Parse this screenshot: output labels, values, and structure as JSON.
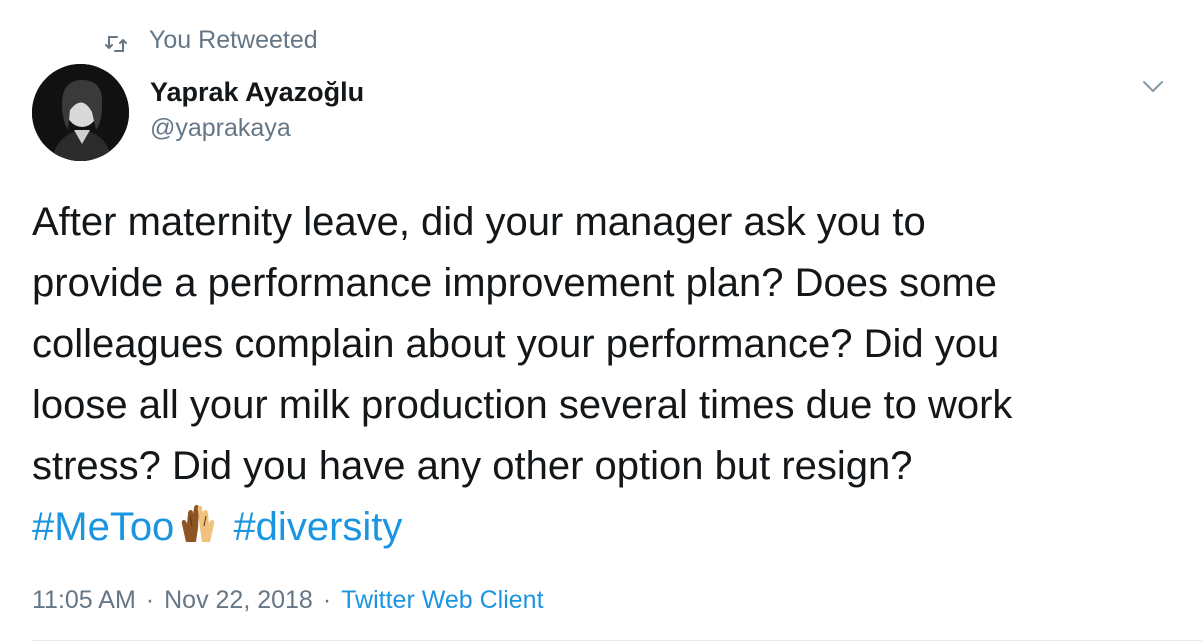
{
  "retweet_context": {
    "icon": "retweet-icon",
    "label": "You Retweeted"
  },
  "author": {
    "avatar_icon": "avatar",
    "name": "Yaprak Ayazoğlu",
    "handle": "@yaprakaya"
  },
  "menu": {
    "icon": "chevron-down-icon"
  },
  "tweet": {
    "lines": [
      "After maternity leave, did your manager ask you to",
      "provide a performance improvement plan? Does some",
      "colleagues complain about your performance? Did you",
      "loose all your milk production several times due to work",
      "stress? Did you have any other option but resign?"
    ],
    "hashtag_1": "#MeToo",
    "emoji": "raising-hands-emoji",
    "hashtag_2": "#diversity"
  },
  "meta": {
    "time": "11:05 AM",
    "separator": "·",
    "date": "Nov 22, 2018",
    "client": "Twitter Web Client"
  },
  "colors": {
    "link": "#1b95e0",
    "secondary_text": "#657786",
    "primary_text": "#14171a"
  }
}
